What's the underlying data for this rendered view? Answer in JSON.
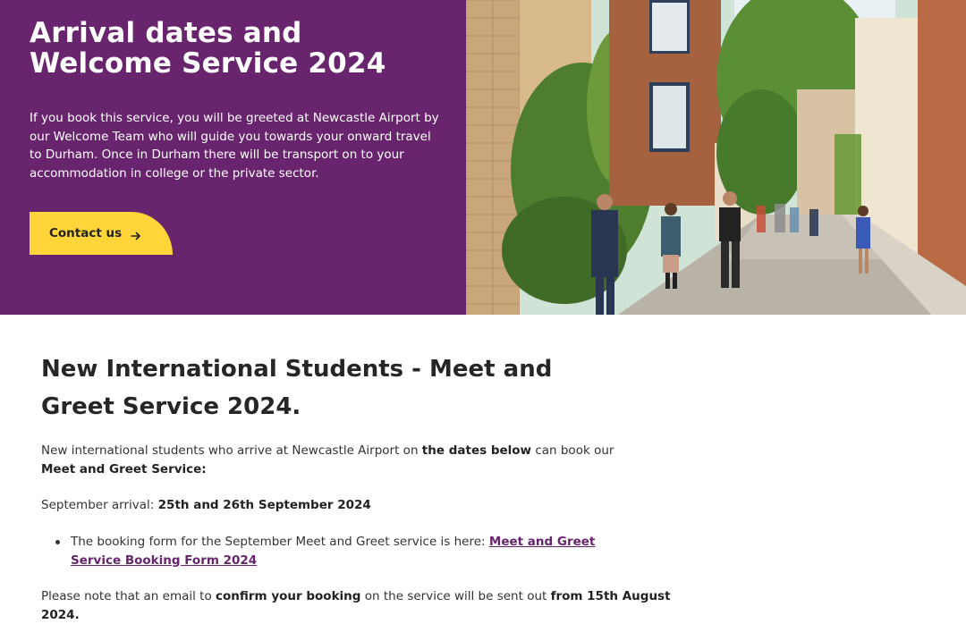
{
  "hero": {
    "title": "Arrival dates and Welcome Service 2024",
    "text": "If you book this service, you will be greeted at Newcastle Airport by our Welcome Team who will guide you towards your onward travel to Durham. Once in Durham there will be transport on to your accommodation in college or the private sector.",
    "contact_label": "Contact us",
    "arrow_icon": "arrow-right-icon",
    "colors": {
      "panel": "#68246d",
      "button": "#ffd53a"
    }
  },
  "main": {
    "title": "New International Students - Meet and Greet Service 2024.",
    "intro": {
      "t1": "New international students who arrive at Newcastle Airport on ",
      "b1": "the dates below",
      "t2": " can book our ",
      "b2": "Meet and Greet Service:"
    },
    "arrival": {
      "label": "September arrival: ",
      "dates": "25th and 26th September 2024"
    },
    "bullet": {
      "text": "The booking form for the September Meet and Greet service is here: ",
      "link": "Meet and Greet Service Booking Form 2024"
    },
    "note": {
      "t1": "Please note that an email to ",
      "b1": "confirm your booking",
      "t2": " on the service will be sent out ",
      "b2": "from 15th August 2024."
    }
  }
}
